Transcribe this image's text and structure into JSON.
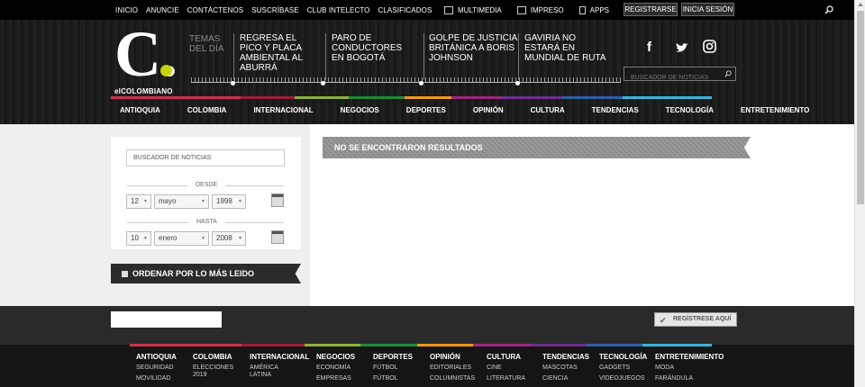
{
  "topbar": {
    "nav": [
      "INICIO",
      "ANUNCIE",
      "CONTÁCTENOS",
      "SUSCRÍBASE",
      "CLUB INTELECTO",
      "CLASIFICADOS"
    ],
    "media": [
      "MULTIMEDIA",
      "IMPRESO",
      "APPS"
    ],
    "register_label": "REGISTRARSE",
    "login_label": "INICIA SESIÓN"
  },
  "header": {
    "logo_letter": "C.",
    "logo_text": "elCOLOMBIANO",
    "temas_label": "TEMAS DEL DÍA",
    "stories": [
      "REGRESA EL PICO Y PLACA AMBIENTAL AL ABURRÁ",
      "PARO DE CONDUCTORES EN BOGOTÁ",
      "GOLPE DE JUSTICIA BRITÁNICA A BORIS JOHNSON",
      "GAVIRIA NO ESTARÁ EN MUNDIAL DE RUTA"
    ],
    "social": [
      "f",
      "twitter",
      "instagram"
    ],
    "search_placeholder": "BUSCADOR DE NOTICIAS"
  },
  "categories": [
    {
      "label": "ANTIOQUIA",
      "color": "#c9354a"
    },
    {
      "label": "COLOMBIA",
      "color": "#c9354a"
    },
    {
      "label": "INTERNACIONAL",
      "color": "#9a1f3d"
    },
    {
      "label": "NEGOCIOS",
      "color": "#8fb03a"
    },
    {
      "label": "DEPORTES",
      "color": "#1f8a3e"
    },
    {
      "label": "OPINIÓN",
      "color": "#f09a1c"
    },
    {
      "label": "CULTURA",
      "color": "#9b2a7a"
    },
    {
      "label": "TENDENCIAS",
      "color": "#6a2f8a"
    },
    {
      "label": "TECNOLOGÍA",
      "color": "#2d5fa6"
    },
    {
      "label": "ENTRETENIMIENTO",
      "color": "#3bb4d8"
    }
  ],
  "sidebar": {
    "search_value": "BUSCADOR DE NOTICIAS",
    "desde_label": "DESDE",
    "desde": {
      "day": "12",
      "month": "mayo",
      "year": "1998"
    },
    "hasta_label": "HASTA",
    "hasta": {
      "day": "10",
      "month": "enero",
      "year": "2008"
    },
    "order_label": "ORDENAR POR LO MÁS LEIDO"
  },
  "results": {
    "message": "NO SE ENCONTRARON RESULTADOS"
  },
  "footer": {
    "register_label": "REGÍSTRESE AQUÍ",
    "columns": [
      {
        "title": "ANTIOQUIA",
        "items": [
          "SEGURIDAD",
          "MOVILIDAD"
        ]
      },
      {
        "title": "COLOMBIA",
        "items": [
          "ELECCIONES 2019"
        ]
      },
      {
        "title": "INTERNACIONAL",
        "items": [
          "AMÉRICA LATINA"
        ]
      },
      {
        "title": "NEGOCIOS",
        "items": [
          "ECONOMÍA",
          "EMPRESAS"
        ]
      },
      {
        "title": "DEPORTES",
        "items": [
          "FÚTBOL",
          "FÚTBOL"
        ]
      },
      {
        "title": "OPINIÓN",
        "items": [
          "EDITORIALES",
          "COLUMNISTAS"
        ]
      },
      {
        "title": "CULTURA",
        "items": [
          "CINE",
          "LITERATURA"
        ]
      },
      {
        "title": "TENDENCIAS",
        "items": [
          "MASCOTAS",
          "CIENCIA"
        ]
      },
      {
        "title": "TECNOLOGÍA",
        "items": [
          "GADGETS",
          "VIDEOJUEGOS"
        ]
      },
      {
        "title": "ENTRETENIMIENTO",
        "items": [
          "MODA",
          "FARÁNDULA"
        ]
      }
    ]
  }
}
